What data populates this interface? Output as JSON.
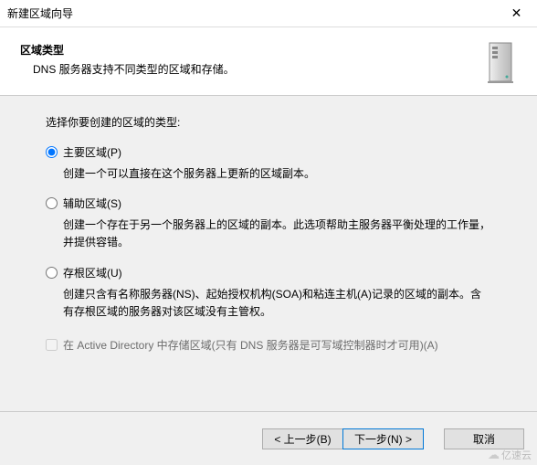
{
  "titlebar": {
    "title": "新建区域向导",
    "close_symbol": "✕"
  },
  "header": {
    "title": "区域类型",
    "subtitle": "DNS 服务器支持不同类型的区域和存储。"
  },
  "main": {
    "intro": "选择你要创建的区域的类型:",
    "options": {
      "primary": {
        "label": "主要区域(P)",
        "desc": "创建一个可以直接在这个服务器上更新的区域副本。"
      },
      "secondary": {
        "label": "辅助区域(S)",
        "desc": "创建一个存在于另一个服务器上的区域的副本。此选项帮助主服务器平衡处理的工作量，并提供容错。"
      },
      "stub": {
        "label": "存根区域(U)",
        "desc": "创建只含有名称服务器(NS)、起始授权机构(SOA)和粘连主机(A)记录的区域的副本。含有存根区域的服务器对该区域没有主管权。"
      }
    },
    "checkbox": {
      "label": "在 Active Directory 中存储区域(只有 DNS 服务器是可写域控制器时才可用)(A)"
    }
  },
  "buttons": {
    "back": "< 上一步(B)",
    "next": "下一步(N) >",
    "cancel": "取消"
  },
  "watermark": {
    "text": "亿速云"
  }
}
